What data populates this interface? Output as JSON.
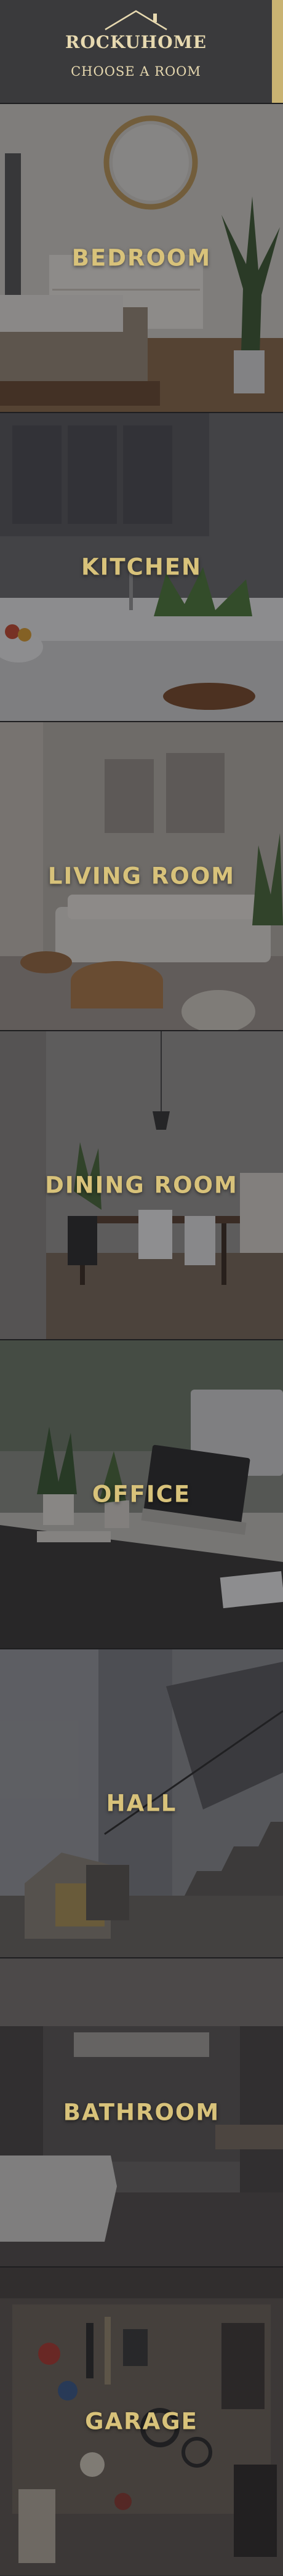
{
  "header": {
    "brand": "ROCKUHOME",
    "subtitle": "CHOOSE A ROOM",
    "logo_icon": "house-roof-icon",
    "accent": "#c9b372"
  },
  "rooms": [
    {
      "label": "BEDROOM"
    },
    {
      "label": "KITCHEN"
    },
    {
      "label": "LIVING ROOM"
    },
    {
      "label": "DINING ROOM"
    },
    {
      "label": "OFFICE"
    },
    {
      "label": "HALL"
    },
    {
      "label": "BATHROOM"
    },
    {
      "label": "GARAGE"
    }
  ],
  "colors": {
    "label": "#d8c27a",
    "header_bg": "#3a3a3c",
    "header_text": "#e7d9b0"
  }
}
